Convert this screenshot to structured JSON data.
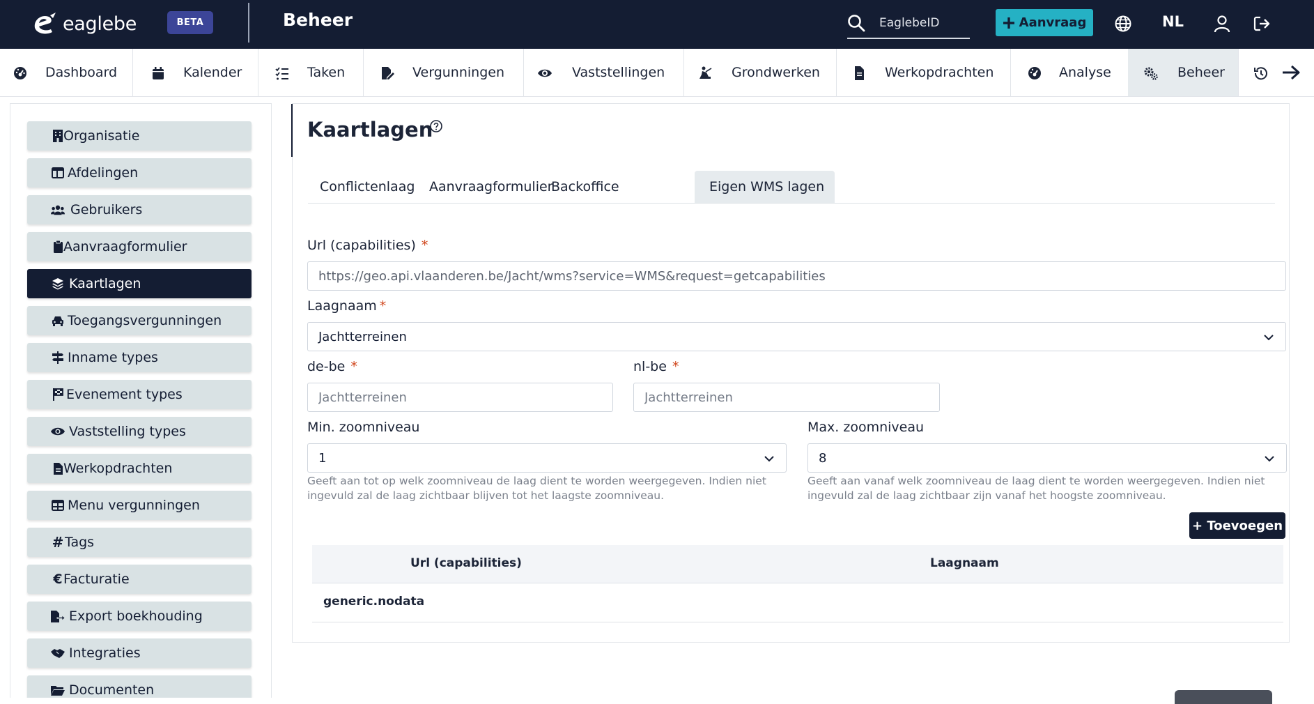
{
  "header": {
    "logo_text": "eaglebe",
    "badge": "BETA",
    "section_title": "Beheer",
    "search_placeholder": "EaglebeID",
    "new_request_label": "Aanvraag",
    "language": "NL"
  },
  "nav": {
    "items": [
      {
        "label": "Dashboard",
        "icon": "dashboard-icon"
      },
      {
        "label": "Kalender",
        "icon": "calendar-icon"
      },
      {
        "label": "Taken",
        "icon": "tasks-icon"
      },
      {
        "label": "Vergunningen",
        "icon": "permit-icon"
      },
      {
        "label": "Vaststellingen",
        "icon": "eye-icon"
      },
      {
        "label": "Grondwerken",
        "icon": "digging-icon"
      },
      {
        "label": "Werkopdrachten",
        "icon": "file-icon"
      },
      {
        "label": "Analyse",
        "icon": "gauge-icon"
      },
      {
        "label": "Beheer",
        "icon": "gears-icon",
        "active": true
      }
    ]
  },
  "sidebar": {
    "items": [
      {
        "label": "Organisatie",
        "icon": "building-icon"
      },
      {
        "label": "Afdelingen",
        "icon": "window-icon"
      },
      {
        "label": "Gebruikers",
        "icon": "users-icon"
      },
      {
        "label": "Aanvraagformulier",
        "icon": "clipboard-icon"
      },
      {
        "label": "Kaartlagen",
        "icon": "layers-icon",
        "active": true
      },
      {
        "label": "Toegangsvergunningen",
        "icon": "car-icon"
      },
      {
        "label": "Inname types",
        "icon": "signpost-icon"
      },
      {
        "label": "Evenement types",
        "icon": "flag-icon"
      },
      {
        "label": "Vaststelling types",
        "icon": "eye-icon"
      },
      {
        "label": "Werkopdrachten",
        "icon": "file-icon"
      },
      {
        "label": "Menu vergunningen",
        "icon": "table-icon"
      },
      {
        "label": "Tags",
        "icon": "hash-icon"
      },
      {
        "label": "Facturatie",
        "icon": "euro-icon"
      },
      {
        "label": "Export boekhouding",
        "icon": "file-export-icon"
      },
      {
        "label": "Integraties",
        "icon": "handshake-icon"
      },
      {
        "label": "Documenten",
        "icon": "folder-icon"
      }
    ]
  },
  "page": {
    "title": "Kaartlagen",
    "tabs": [
      {
        "label": "Conflictenlaag"
      },
      {
        "label": "Aanvraagformulier"
      },
      {
        "label": "Backoffice"
      },
      {
        "label": "Eigen WMS lagen",
        "active": true
      }
    ]
  },
  "form": {
    "url_label": "Url (capabilities)",
    "url_value": "https://geo.api.vlaanderen.be/Jacht/wms?service=WMS&request=getcapabilities",
    "layer_label": "Laagnaam",
    "layer_value": "Jachtterreinen",
    "de_label": "de-be",
    "de_placeholder": "Jachtterreinen",
    "nl_label": "nl-be",
    "nl_placeholder": "Jachtterreinen",
    "min_zoom_label": "Min. zoomniveau",
    "min_zoom_value": "1",
    "min_zoom_hint": "Geeft aan tot op welk zoomniveau de laag dient te worden weergegeven. Indien niet ingevuld zal de laag zichtbaar blijven tot het laagste zoomniveau.",
    "max_zoom_label": "Max. zoomniveau",
    "max_zoom_value": "8",
    "max_zoom_hint": "Geeft aan vanaf welk zoomniveau de laag dient te worden weergegeven. Indien niet ingevuld zal de laag zichtbaar zijn vanaf het hoogste zoomniveau.",
    "required_mark": "*",
    "add_label": "+ Toevoegen"
  },
  "table": {
    "columns": [
      "Url (capabilities)",
      "Laagnaam"
    ],
    "rows": [
      [
        "generic.nodata",
        ""
      ]
    ]
  },
  "colors": {
    "navy": "#141d33",
    "accent": "#25b1c4",
    "sidebar_item": "#d9e2e4",
    "required": "#d0461c"
  }
}
